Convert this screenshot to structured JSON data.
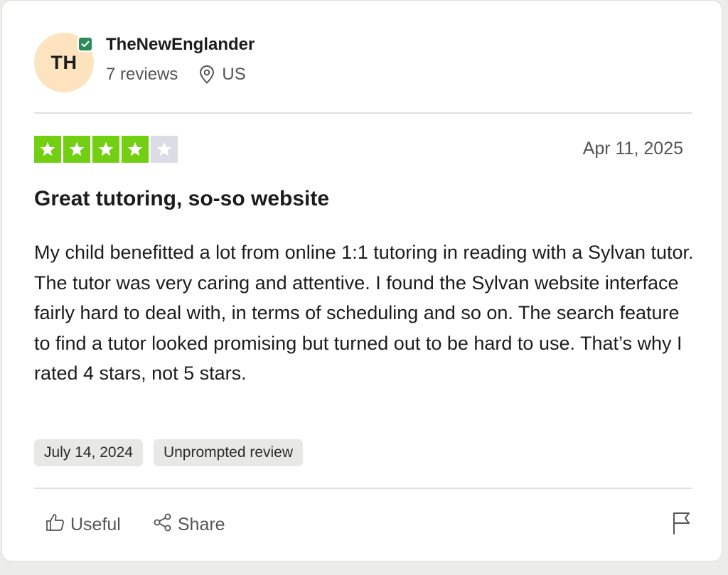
{
  "reviewer": {
    "initials": "TH",
    "name": "TheNewEnglander",
    "reviews_count": "7 reviews",
    "country": "US",
    "verified_icon": "verified-check-icon",
    "avatar_color": "#fde4bf"
  },
  "review": {
    "rating": 4,
    "max_rating": 5,
    "star_color": "#73cf11",
    "empty_star_color": "#dcdce6",
    "date": "Apr 11, 2025",
    "title": "Great tutoring, so-so website",
    "body": "My child benefitted a lot from online 1:1 tutoring in reading with a Sylvan tutor. The tutor was very caring and attentive. I found the Sylvan website interface fairly hard to deal with, in terms of scheduling and so on. The search feature to find a tutor looked promising but turned out to be hard to use. That’s why I rated 4 stars, not 5 stars.",
    "tags": {
      "experience_date": "July 14, 2024",
      "type": "Unprompted review"
    }
  },
  "actions": {
    "useful_label": "Useful",
    "share_label": "Share",
    "useful_icon": "thumbs-up-icon",
    "share_icon": "share-icon",
    "flag_icon": "flag-icon"
  }
}
